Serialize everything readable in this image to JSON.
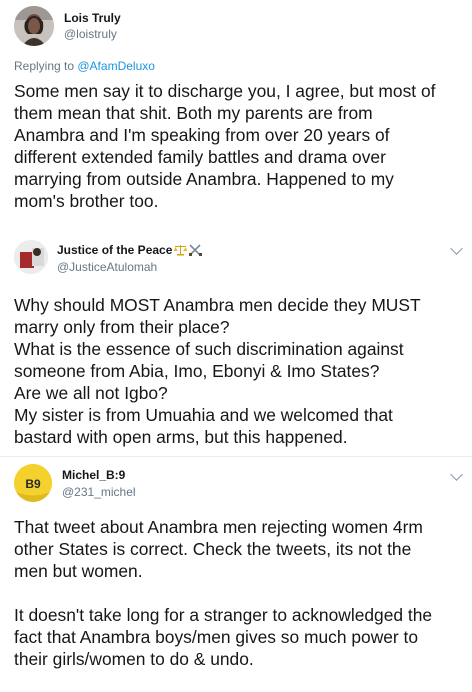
{
  "tweets": [
    {
      "name": "Lois Truly",
      "handle": "@loistruly",
      "reply_prefix": "Replying to ",
      "reply_to": "@AfamDeluxo",
      "body": [
        "Some men say it to discharge you, I agree, but most of",
        "them mean that shit. Both my parents are from",
        "Anambra and I'm speaking from over 20 years of",
        "different extended family battles and drama over",
        "marrying from outside Anambra. Happened to my",
        "mom's brother too."
      ]
    },
    {
      "name": "Justice of the Peace",
      "handle": "@JusticeAtulomah",
      "name_emoji": "balance-scale-and-crossed-swords",
      "body": [
        "Why should MOST Anambra men decide they MUST",
        "marry only from their place?",
        "What is the essence of such discrimination against",
        "someone from Abia, Imo, Ebonyi & Imo States?",
        "Are we all not Igbo?",
        "My sister is from Umuahia and we welcomed that",
        "bastard with open arms, but this happened."
      ]
    },
    {
      "name": "Michel_B:9",
      "handle": "@231_michel",
      "avatar_text": "B9",
      "body": [
        "That tweet about Anambra men rejecting women 4rm",
        "other States is correct. Check the tweets, its not the",
        "men but women.",
        "",
        "It doesn't take long for a stranger to acknowledged the",
        "fact that Anambra boys/men gives so much power to",
        "their girls/women to do & undo."
      ]
    }
  ],
  "colors": {
    "link": "#1b95e0",
    "secondary": "#657786",
    "text": "#14171a",
    "divider": "#e6ecf0"
  }
}
